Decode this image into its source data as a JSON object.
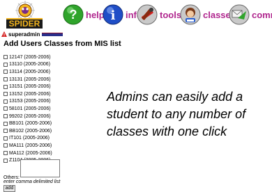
{
  "app": {
    "logo_text": "SPIDER"
  },
  "nav": {
    "help": "help",
    "info": "info",
    "tools": "tools",
    "classes": "classes",
    "comm": "comm"
  },
  "user": {
    "name": "superadmin"
  },
  "page": {
    "title": "Add Users Classes from MIS list"
  },
  "classes": [
    "12147 (2005-2006)",
    "13110 (2005-2006)",
    "13114 (2005-2006)",
    "13131 (2005-2006)",
    "13151 (2005-2006)",
    "13152 (2005-2006)",
    "13153 (2005-2006)",
    "58101 (2005-2006)",
    "99202 (2005-2006)",
    "BB101 (2005-2006)",
    "BB102 (2005-2006)",
    "IT101 (2005-2006)",
    "MA111 (2005-2006)",
    "MA112 (2005-2006)",
    "Z1104 (2005-2006)"
  ],
  "form": {
    "others_label": "Others:",
    "hint": "enter comma delimited list",
    "add_label": "add"
  },
  "caption": "Admins can easily add a student to any number of classes with one click",
  "colors": {
    "nav_text": "#b0268e",
    "help_icon": "#2fa42b",
    "info_icon": "#1f4ec7"
  }
}
